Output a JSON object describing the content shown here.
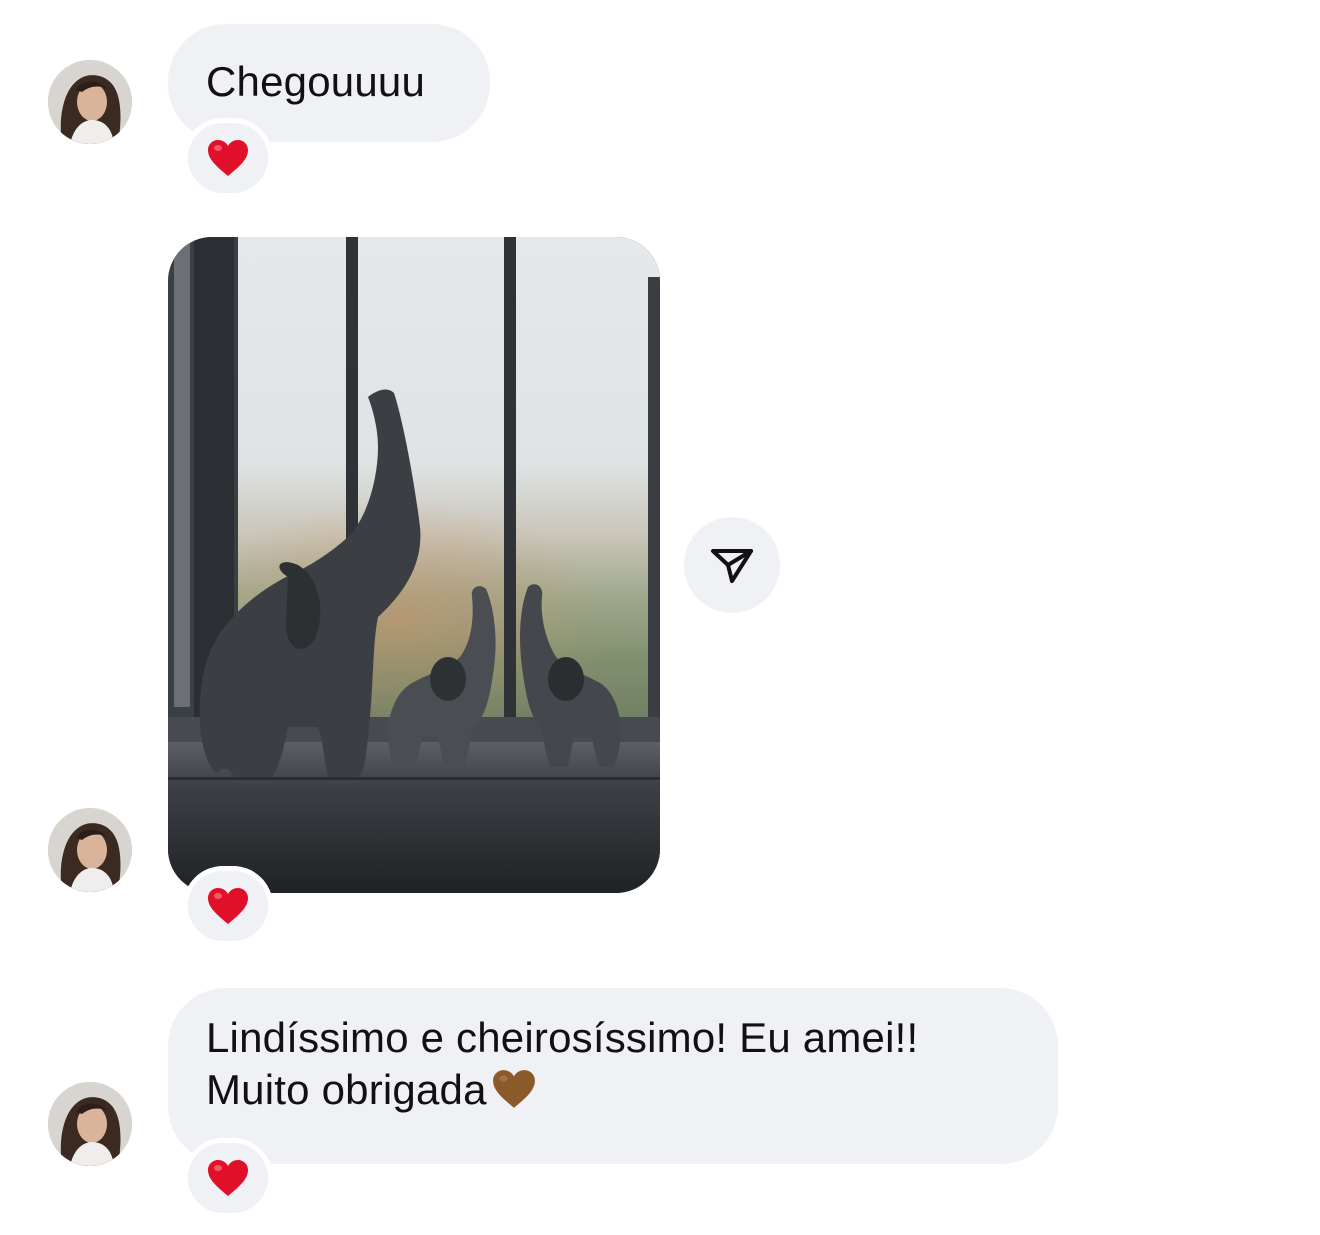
{
  "contact": {
    "avatar_icon": "profile-photo-avatar"
  },
  "messages": [
    {
      "type": "text",
      "lines": [
        "Chegouuuu"
      ],
      "reaction": "red-heart"
    },
    {
      "type": "photo",
      "photo_description_icon": "elephant-figurines-photo",
      "reaction": "red-heart"
    },
    {
      "type": "text",
      "lines": [
        "Lindíssimo e cheirosíssimo! Eu amei!!",
        "Muito obrigada"
      ],
      "trailing_emoji": "brown-heart",
      "reaction": "red-heart"
    }
  ],
  "actions": {
    "share_icon": "send-paper-plane-icon"
  },
  "colors": {
    "bubble": "#f0f1f4",
    "text": "#111111",
    "reaction_heart": "#e0102a",
    "brown_heart": "#8b5a2b"
  }
}
